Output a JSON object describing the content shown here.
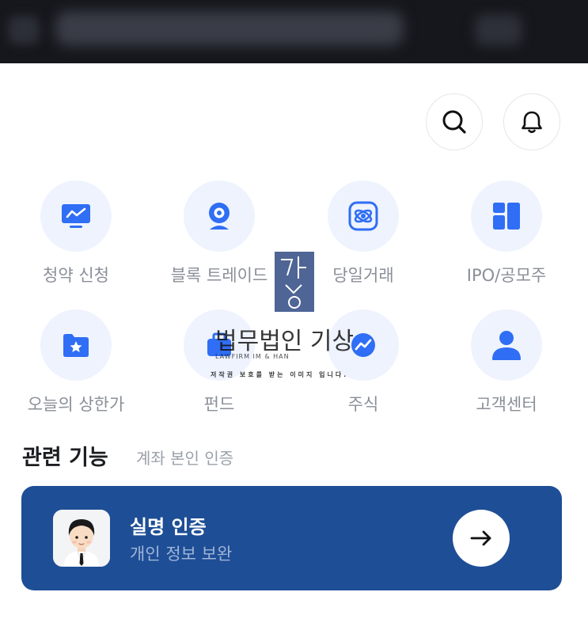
{
  "header": {
    "search_icon": "search-icon",
    "notification_icon": "bell-icon"
  },
  "menu": {
    "items": [
      {
        "label": "청약 신청",
        "icon": "monitor-chart-icon"
      },
      {
        "label": "블록 트레이드",
        "icon": "webcam-icon"
      },
      {
        "label": "당일거래",
        "icon": "exchange-cycle-icon"
      },
      {
        "label": "IPO/공모주",
        "icon": "grid-blocks-icon"
      },
      {
        "label": "오늘의 상한가",
        "icon": "star-folder-icon"
      },
      {
        "label": "펀드",
        "icon": "fund-icon"
      },
      {
        "label": "주식",
        "icon": "stock-icon"
      },
      {
        "label": "고객센터",
        "icon": "person-icon"
      }
    ]
  },
  "related": {
    "title": "관련 기능",
    "subtitle": "계좌 본인 인증"
  },
  "card": {
    "title": "실명 인증",
    "subtitle": "개인 정보 보완"
  },
  "watermark": {
    "kor": "법무법인 기상",
    "eng": "LAWFIRM IM & HAN",
    "note": "저작권 보호를 받는 이미지 입니다."
  },
  "colors": {
    "accent": "#2f6ef5",
    "card_bg": "#1e4e96",
    "icon_bg": "#eef3fe"
  }
}
